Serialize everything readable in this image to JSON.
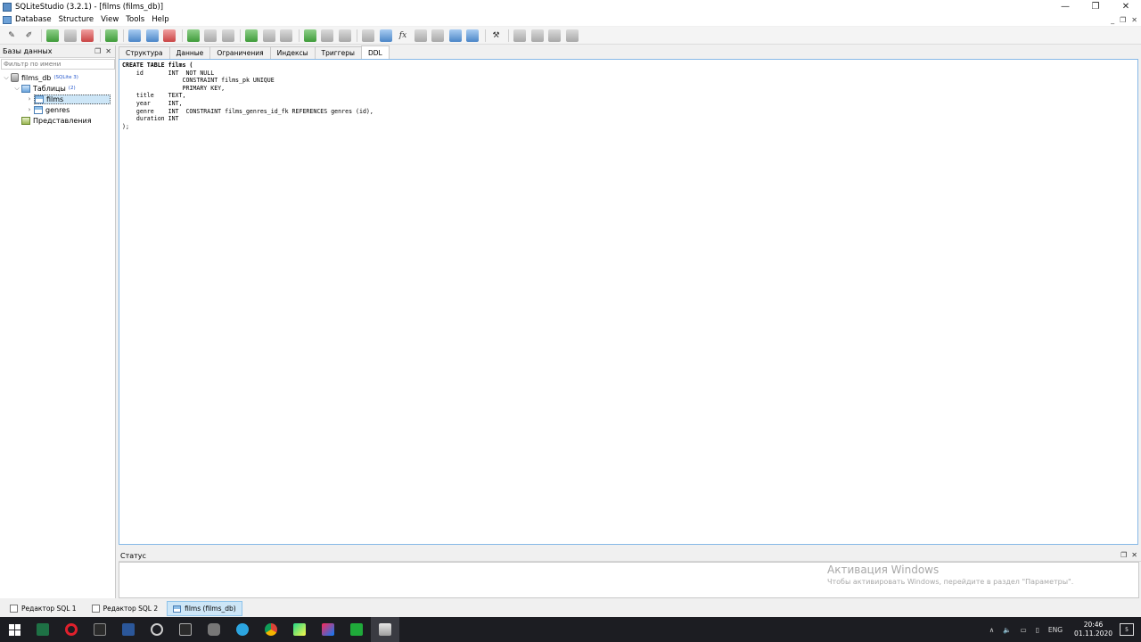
{
  "window": {
    "title": "SQLiteStudio (3.2.1) - [films (films_db)]",
    "controls": {
      "minimize": "—",
      "maximize": "❐",
      "close": "✕"
    }
  },
  "menu": {
    "items": [
      "Database",
      "Structure",
      "View",
      "Tools",
      "Help"
    ],
    "mdi": {
      "minimize": "_",
      "restore": "❐",
      "close": "✕"
    }
  },
  "left_panel": {
    "title": "Базы данных",
    "filter_placeholder": "Фильтр по имени",
    "tree": {
      "db_name": "films_db",
      "db_badge": "(SQLite 3)",
      "tables_label": "Таблицы",
      "tables_count": "(2)",
      "tables": [
        "films",
        "genres"
      ],
      "views_label": "Представления"
    }
  },
  "tabs": [
    "Структура",
    "Данные",
    "Ограничения",
    "Индексы",
    "Триггеры",
    "DDL"
  ],
  "active_tab": "DDL",
  "ddl": [
    "CREATE TABLE films (",
    "    id       INT  NOT NULL",
    "                 CONSTRAINT films_pk UNIQUE",
    "                 PRIMARY KEY,",
    "    title    TEXT,",
    "    year     INT,",
    "    genre    INT  CONSTRAINT films_genres_id_fk REFERENCES genres (id),",
    "    duration INT",
    ");"
  ],
  "status_panel": {
    "title": "Статус"
  },
  "activation": {
    "line1": "Активация Windows",
    "line2": "Чтобы активировать Windows, перейдите в раздел \"Параметры\"."
  },
  "bottom_tabs": [
    "Редактор SQL 1",
    "Редактор SQL 2",
    "films (films_db)"
  ],
  "taskbar": {
    "lang": "ENG",
    "time": "20:46",
    "date": "01.11.2020",
    "notifications": "5"
  }
}
